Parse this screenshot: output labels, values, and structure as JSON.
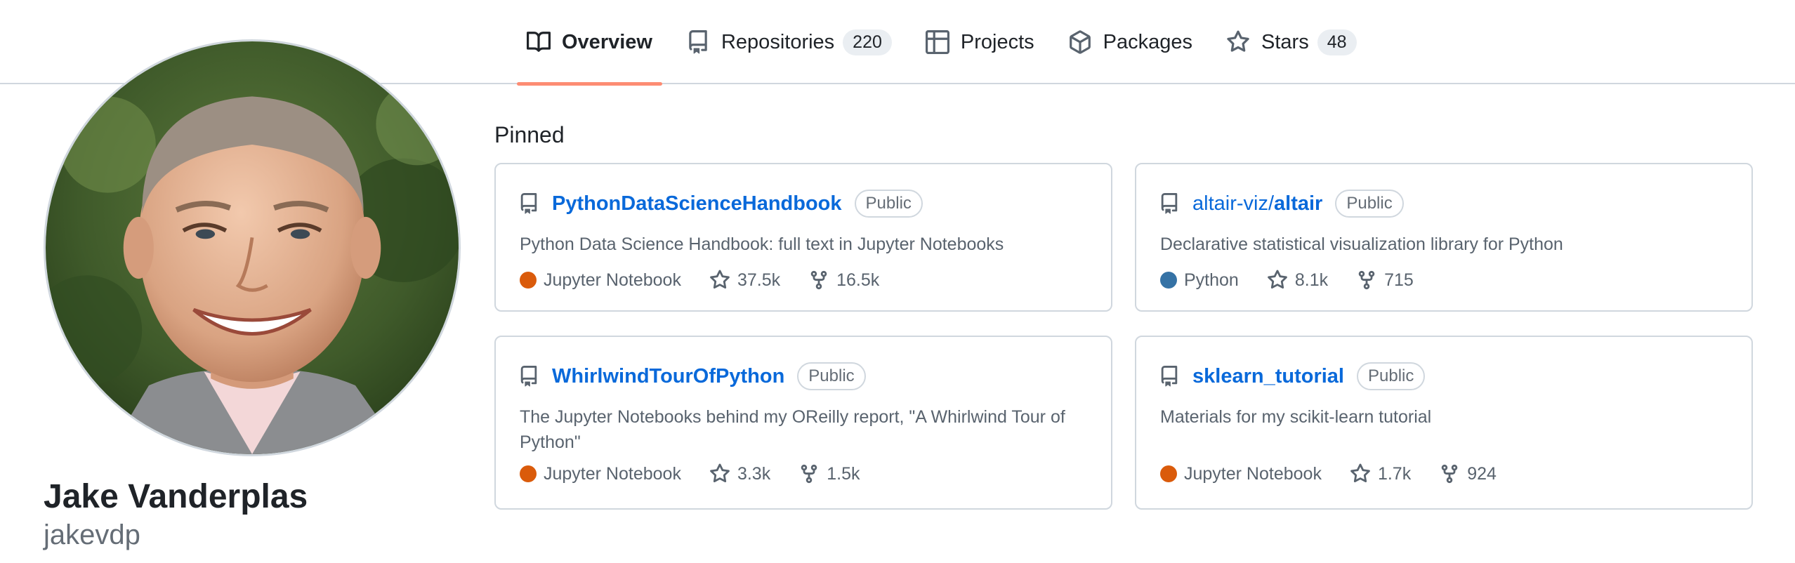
{
  "nav": {
    "tabs": [
      {
        "label": "Overview",
        "icon": "book-icon",
        "count": ""
      },
      {
        "label": "Repositories",
        "icon": "repo-icon",
        "count": "220"
      },
      {
        "label": "Projects",
        "icon": "table-icon",
        "count": ""
      },
      {
        "label": "Packages",
        "icon": "package-icon",
        "count": ""
      },
      {
        "label": "Stars",
        "icon": "star-icon",
        "count": "48"
      }
    ],
    "active_tab": "Overview",
    "active_underline_color": "#fd8c73"
  },
  "profile": {
    "name": "Jake Vanderplas",
    "login": "jakevdp"
  },
  "pinned": {
    "title": "Pinned",
    "repos": [
      {
        "owner": "",
        "name": "PythonDataScienceHandbook",
        "visibility": "Public",
        "description": "Python Data Science Handbook: full text in Jupyter Notebooks",
        "language": "Jupyter Notebook",
        "language_color": "#DA5B0B",
        "stars": "37.5k",
        "forks": "16.5k"
      },
      {
        "owner": "altair-viz/",
        "name": "altair",
        "visibility": "Public",
        "description": "Declarative statistical visualization library for Python",
        "language": "Python",
        "language_color": "#3572A5",
        "stars": "8.1k",
        "forks": "715"
      },
      {
        "owner": "",
        "name": "WhirlwindTourOfPython",
        "visibility": "Public",
        "description": "The Jupyter Notebooks behind my OReilly report, \"A Whirlwind Tour of Python\"",
        "language": "Jupyter Notebook",
        "language_color": "#DA5B0B",
        "stars": "3.3k",
        "forks": "1.5k"
      },
      {
        "owner": "",
        "name": "sklearn_tutorial",
        "visibility": "Public",
        "description": "Materials for my scikit-learn tutorial",
        "language": "Jupyter Notebook",
        "language_color": "#DA5B0B",
        "stars": "1.7k",
        "forks": "924"
      }
    ]
  }
}
